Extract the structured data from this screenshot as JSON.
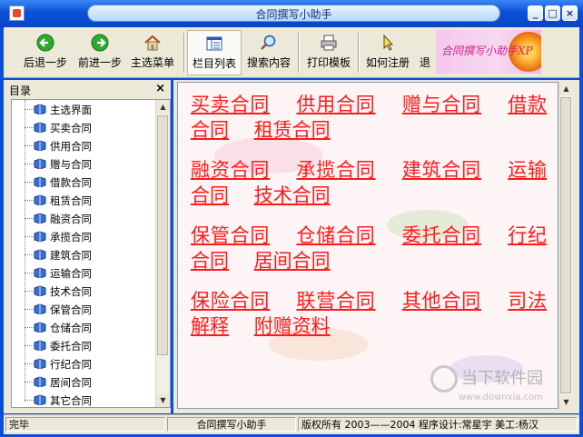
{
  "window": {
    "title": "合同撰写小助手"
  },
  "toolbar": {
    "back": "后退一步",
    "forward": "前进一步",
    "home": "主选菜单",
    "columns": "栏目列表",
    "search": "搜索内容",
    "print": "打印模板",
    "register": "如何注册",
    "exit": "退",
    "brand_text": "合同撰写小助手XP"
  },
  "sidebar": {
    "title": "目录",
    "close": "×",
    "items": [
      "主选界面",
      "买卖合同",
      "供用合同",
      "赠与合同",
      "借款合同",
      "租赁合同",
      "融资合同",
      "承揽合同",
      "建筑合同",
      "运输合同",
      "技术合同",
      "保管合同",
      "仓储合同",
      "委托合同",
      "行纪合同",
      "居间合同",
      "其它合同"
    ]
  },
  "content": {
    "groups": [
      [
        "买卖合同",
        "供用合同",
        "赠与合同",
        "借款合同",
        "租赁合同"
      ],
      [
        "融资合同",
        "承揽合同",
        "建筑合同",
        "运输合同",
        "技术合同"
      ],
      [
        "保管合同",
        "仓储合同",
        "委托合同",
        "行纪合同",
        "居间合同"
      ],
      [
        "保险合同",
        "联营合同",
        "其他合同",
        "司法解释",
        "附赠资料"
      ]
    ]
  },
  "watermark": {
    "text": "当下软件园",
    "url": "www.downxia.com"
  },
  "status": {
    "state": "完毕",
    "app": "合同撰写小助手",
    "copyright": "版权所有 2003——2004 程序设计:常星宇 美工:杨汉"
  },
  "colors": {
    "link": "#ff1a1a",
    "titlebar": "#0a50d8",
    "chrome": "#ece9d8"
  }
}
